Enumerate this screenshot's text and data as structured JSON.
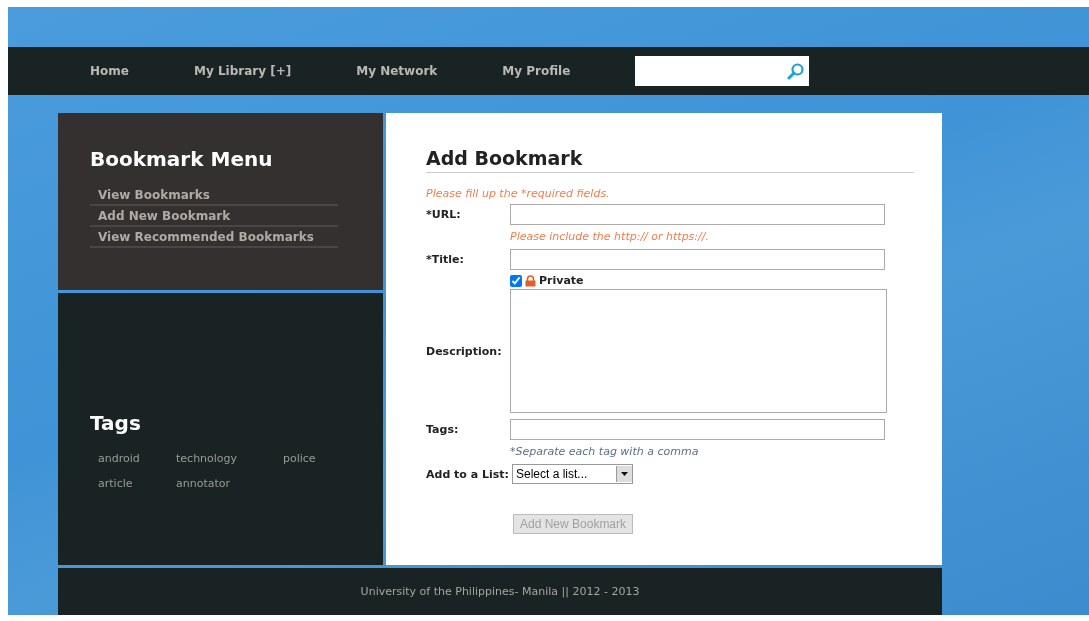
{
  "nav": {
    "items": [
      {
        "label": "Home"
      },
      {
        "label": "My Library [+]"
      },
      {
        "label": "My Network"
      },
      {
        "label": "My Profile"
      }
    ]
  },
  "sidebar": {
    "menu_title": "Bookmark Menu",
    "menu_items": [
      "View Bookmarks",
      "Add New Bookmark",
      "View Recommended Bookmarks"
    ],
    "tags_title": "Tags",
    "tags": [
      "android",
      "technology",
      "police",
      "article",
      "annotator"
    ]
  },
  "form": {
    "title": "Add Bookmark",
    "required_note": "Please fill up the *required fields.",
    "fields": [
      {
        "kind": "text",
        "label": "*URL:",
        "hint": {
          "text": "Please include the http:// or https://.",
          "color": "#f27c4a"
        }
      },
      {
        "kind": "text",
        "label": "*Title:"
      },
      {
        "kind": "checkbox",
        "label": "Private",
        "checked": true
      },
      {
        "kind": "textarea",
        "label": "Description:"
      },
      {
        "kind": "text",
        "label": "Tags:",
        "hint": {
          "text": "*Separate each tag with a comma",
          "color": "#5a6e8c"
        }
      },
      {
        "kind": "select",
        "label": "Add to a List:",
        "value": "Select a list..."
      }
    ],
    "submit": {
      "label": "Add New Bookmark",
      "disabled": true
    }
  },
  "footer": "University of the Philippines- Manila || 2012 - 2013"
}
